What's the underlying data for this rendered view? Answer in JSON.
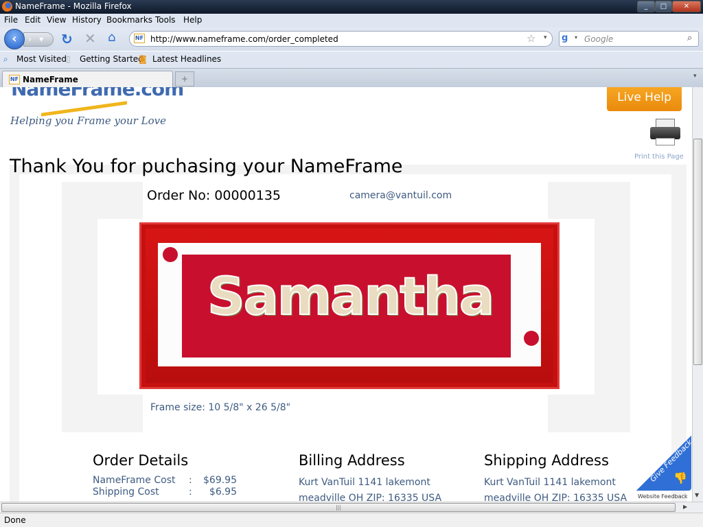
{
  "window": {
    "title": "NameFrame - Mozilla Firefox",
    "controls": [
      "minimize",
      "maximize",
      "close"
    ]
  },
  "menu": [
    "File",
    "Edit",
    "View",
    "History",
    "Bookmarks",
    "Tools",
    "Help"
  ],
  "nav": {
    "url": "http://www.nameframe.com/order_completed",
    "search_placeholder": "Google"
  },
  "bookmarks": [
    "Most Visited",
    "Getting Started",
    "Latest Headlines"
  ],
  "tab": {
    "label": "NameFrame",
    "favicon": "NF"
  },
  "page": {
    "logo_text": "NameFrame.com",
    "tagline": "Helping you Frame your Love",
    "live_help": "Live Help",
    "print_label": "Print this Page",
    "heading": "Thank You for puchasing your NameFrame",
    "order_no": "Order No: 00000135",
    "email": "camera@vantuil.com",
    "frame_name": "Samantha",
    "frame_size": "Frame size: 10 5/8\" x 26 5/8\"",
    "order_details": {
      "title": "Order Details",
      "rows": [
        {
          "label": "NameFrame Cost",
          "value": "$69.95"
        },
        {
          "label": "Shipping Cost",
          "value": "$6.95"
        }
      ]
    },
    "billing": {
      "title": "Billing Address",
      "line1": "Kurt VanTuil 1141 lakemont",
      "line2": "meadville OH ZIP: 16335 USA"
    },
    "shipping": {
      "title": "Shipping Address",
      "line1": "Kurt VanTuil 1141 lakemont",
      "line2": "meadville OH ZIP: 16335 USA"
    },
    "feedback": {
      "badge": "Give Feedback",
      "caption": "Website Feedback"
    },
    "colors": {
      "accent": "#f39c12",
      "frame": "#cc1111",
      "mat": "#c8102e",
      "text_blue": "#3d5a80"
    }
  },
  "status": "Done"
}
